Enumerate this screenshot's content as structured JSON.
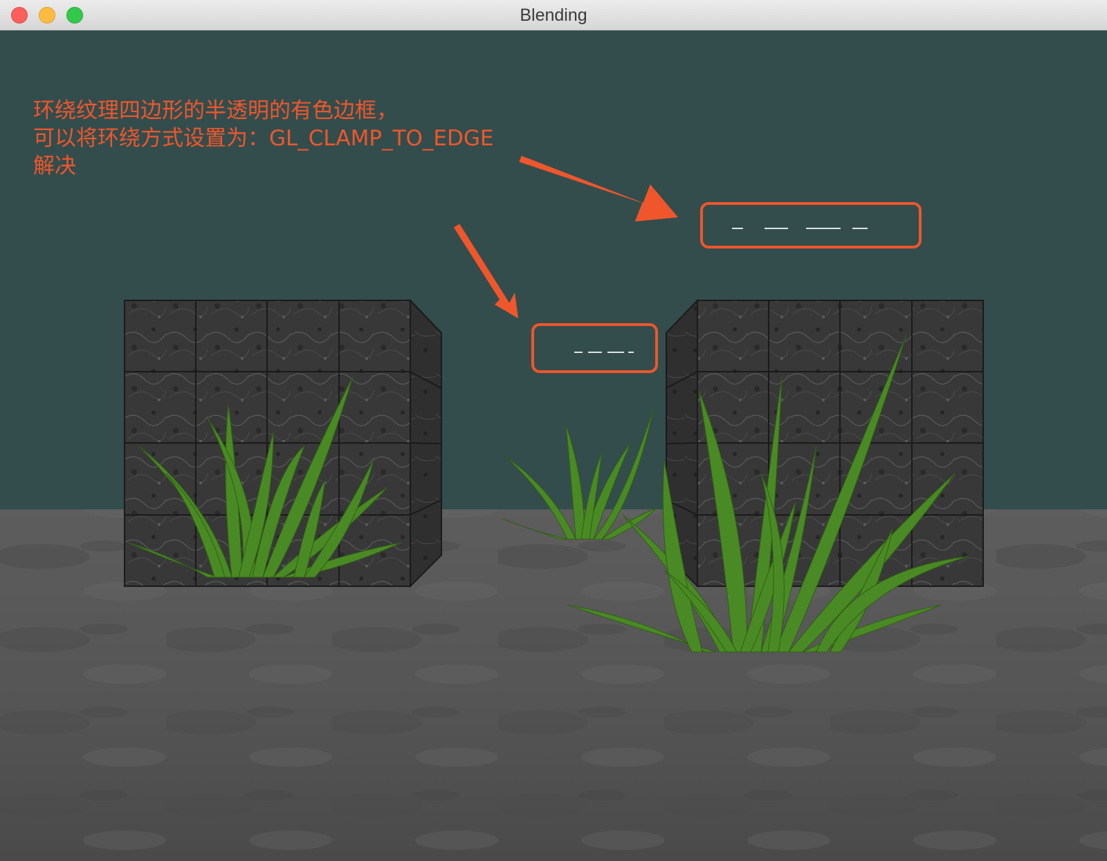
{
  "window": {
    "title": "Blending",
    "controls": [
      "close-icon",
      "minimize-icon",
      "maximize-icon"
    ]
  },
  "scene": {
    "clear_color": "#334d4d",
    "floor_color": "#5a5a5a",
    "cube_color": "#3a3a3a",
    "grass_color": "#4a8a24"
  },
  "annotation": {
    "color": "#f0562b",
    "lines": [
      "环绕纹理四边形的半透明的有色边框，",
      "可以将环绕方式设置为：GL_CLAMP_TO_EDGE",
      "解决"
    ]
  }
}
